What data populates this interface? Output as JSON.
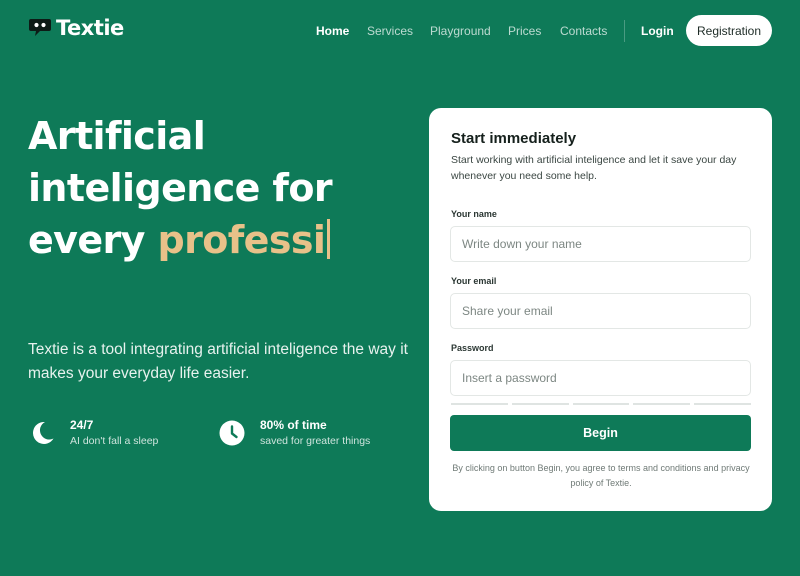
{
  "brand": {
    "name": "Textie",
    "icon": "chat-bubble-icon"
  },
  "nav": {
    "items": [
      {
        "label": "Home",
        "active": true
      },
      {
        "label": "Services",
        "active": false
      },
      {
        "label": "Playground",
        "active": false
      },
      {
        "label": "Prices",
        "active": false
      },
      {
        "label": "Contacts",
        "active": false
      }
    ],
    "login_label": "Login",
    "register_label": "Registration"
  },
  "hero": {
    "title_line_1": "Artificial",
    "title_line_2": "inteligence for",
    "title_line_3_prefix": "every",
    "title_typed": "professi",
    "description": "Textie is a tool integrating artificial inteligence the way it makes your everyday life easier.",
    "features": [
      {
        "icon": "moon-icon",
        "title": "24/7",
        "subtitle": "AI don't fall a sleep"
      },
      {
        "icon": "clock-icon",
        "title": "80% of time",
        "subtitle": "saved for greater things"
      }
    ]
  },
  "signup": {
    "title": "Start immediately",
    "description": "Start working with artificial inteligence and let it save your day whenever you need some help.",
    "name_label": "Your name",
    "name_placeholder": "Write down your name",
    "name_value": "",
    "email_label": "Your email",
    "email_placeholder": "Share your email",
    "email_value": "",
    "password_label": "Password",
    "password_placeholder": "Insert a password",
    "password_value": "",
    "submit_label": "Begin",
    "terms": "By clicking on button Begin, you agree to terms and conditions and privacy policy of Textie."
  },
  "colors": {
    "background": "#0e7a58",
    "accent": "#e8c189",
    "button": "#0e7a58",
    "card": "#ffffff"
  }
}
